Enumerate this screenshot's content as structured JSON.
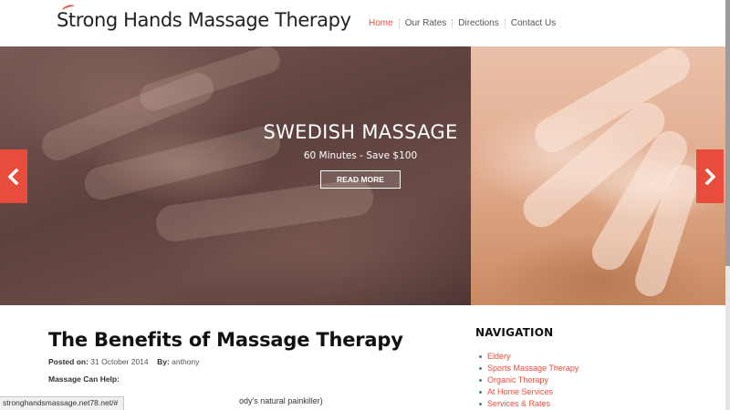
{
  "header": {
    "logo_text": "Strong Hands Massage Therapy",
    "nav": [
      {
        "label": "Home",
        "active": true
      },
      {
        "label": "Our Rates",
        "active": false
      },
      {
        "label": "Directions",
        "active": false
      },
      {
        "label": "Contact Us",
        "active": false
      }
    ]
  },
  "slider": {
    "title": "SWEDISH MASSAGE",
    "subtitle": "60 Minutes - Save $100",
    "button_label": "READ MORE",
    "prev_icon": "chevron-left-icon",
    "next_icon": "chevron-right-icon"
  },
  "post": {
    "title": "The Benefits of Massage Therapy",
    "posted_on_label": "Posted on:",
    "posted_on_value": "31 October 2014",
    "by_label": "By:",
    "by_value": "anthony",
    "lead": "Massage Can Help:",
    "partial_line": "ody's natural painkiller)"
  },
  "sidebar": {
    "title": "NAVIGATION",
    "items": [
      {
        "label": "Eldery"
      },
      {
        "label": "Sports Massage Therapy"
      },
      {
        "label": "Organic Therapy"
      },
      {
        "label": "At Home Services"
      },
      {
        "label": "Services & Rates"
      }
    ]
  },
  "status_bar": {
    "url": "stronghandsmassage.net78.net/#"
  },
  "colors": {
    "accent": "#e84c3d",
    "text_dark": "#111111"
  }
}
